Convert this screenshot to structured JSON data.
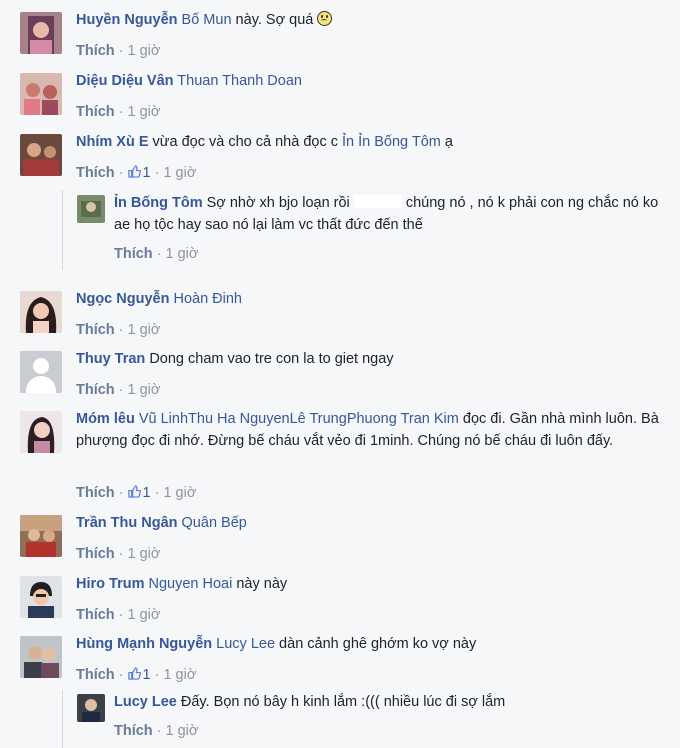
{
  "comments": [
    {
      "name": "Huyền Nguyễn",
      "tag": "Bố Mun",
      "text": " này. Sợ quá",
      "emoji": "frown-emoji",
      "like": "Thích",
      "time": "1 giờ"
    },
    {
      "name": "Diệu Diệu Vân",
      "tag": "Thuan Thanh Doan",
      "text": "",
      "like": "Thích",
      "time": "1 giờ"
    },
    {
      "name": "Nhím Xù E",
      "text": "vừa đọc và cho cả nhà đọc c",
      "tag": "Ỉn Ỉn Bống Tôm",
      "text2": " ạ",
      "like": "Thích",
      "likes": "1",
      "time": "1 giờ"
    },
    {
      "name": "Ỉn Bống Tôm",
      "text": "Sợ nhờ xh bjo loạn rồi",
      "text_b": "chúng nó , nó k phải con ng chắc nó ko ae họ tộc hay sao nó lại làm vc thất đức đến thế",
      "like": "Thích",
      "time": "1 giờ"
    },
    {
      "name": "Ngọc Nguyễn",
      "tag": "Hoàn Đinh",
      "like": "Thích",
      "time": "1 giờ"
    },
    {
      "name": "Thuy Tran",
      "text": "Dong cham vao tre con la to giet ngay",
      "like": "Thích",
      "time": "1 giờ"
    },
    {
      "name": "Móm lêu",
      "tag": "Vũ LinhThu Ha NguyenLê TrungPhuong Tran Kim",
      "text": " đọc đi. Gần nhà mình luôn. Bà phượng đọc đi nhớ. Đừng bế cháu vắt vẻo đi 1minh. Chúng nó bế cháu đi luôn đấy.",
      "like": "Thích",
      "likes": "1",
      "time": "1 giờ"
    },
    {
      "name": "Trần Thu Ngân",
      "tag": "Quân Bếp",
      "like": "Thích",
      "time": "1 giờ"
    },
    {
      "name": "Hiro Trum",
      "tag": "Nguyen Hoai",
      "text": " này này",
      "like": "Thích",
      "time": "1 giờ"
    },
    {
      "name": "Hùng Mạnh Nguyễn",
      "tag": "Lucy Lee",
      "text": " dàn cảnh ghê ghớm ko vợ này",
      "like": "Thích",
      "likes": "1",
      "time": "1 giờ"
    },
    {
      "name": "Lucy Lee",
      "text": "Đấy. Bọn nó bây h kinh lắm :((( nhiều lúc đi sợ lắm",
      "like": "Thích",
      "time": "1 giờ"
    }
  ],
  "separator": "·",
  "colors": {
    "name": "#365899",
    "meta": "#90949c",
    "background": "#f6f7f9"
  }
}
